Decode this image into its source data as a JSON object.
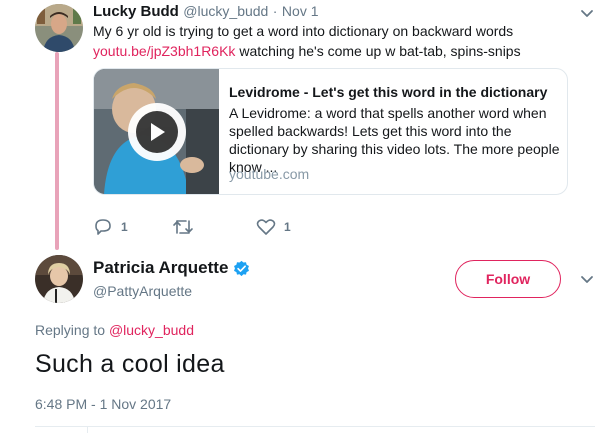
{
  "parent_tweet": {
    "author_name": "Lucky Budd",
    "author_handle": "@lucky_budd",
    "separator": "·",
    "date": "Nov 1",
    "text_line1": "My 6 yr old is trying to get a word into dictionary on backward words",
    "link": "youtu.be/jpZ3bh1R6Kk",
    "text_line2_rest": " watching he's come up w bat-tab, spins-snips",
    "card": {
      "title": "Levidrome - Let's get this word in the dictionary",
      "description": "A Levidrome: a word that spells another word when spelled backwards! Lets get this word into the dictionary by sharing this video lots. The more people know ...",
      "domain": "youtube.com"
    },
    "actions": {
      "reply_count": "1",
      "retweet_count": "",
      "like_count": "1"
    }
  },
  "main_tweet": {
    "author_name": "Patricia Arquette",
    "author_handle": "@PattyArquette",
    "follow_label": "Follow",
    "replying_to_prefix": "Replying to ",
    "replying_to_handle": "@lucky_budd",
    "text": "Such a cool idea",
    "timestamp": "6:48 PM - 1 Nov 2017"
  },
  "colors": {
    "accent": "#e0245e",
    "verified": "#1da1f2",
    "thread_line": "#e8a3b9",
    "secondary_text": "#657786"
  },
  "icons": {
    "reply": "reply-icon",
    "retweet": "retweet-icon",
    "like": "heart-icon",
    "menu": "chevron-down-icon",
    "verified": "verified-badge-icon",
    "play": "play-icon"
  }
}
